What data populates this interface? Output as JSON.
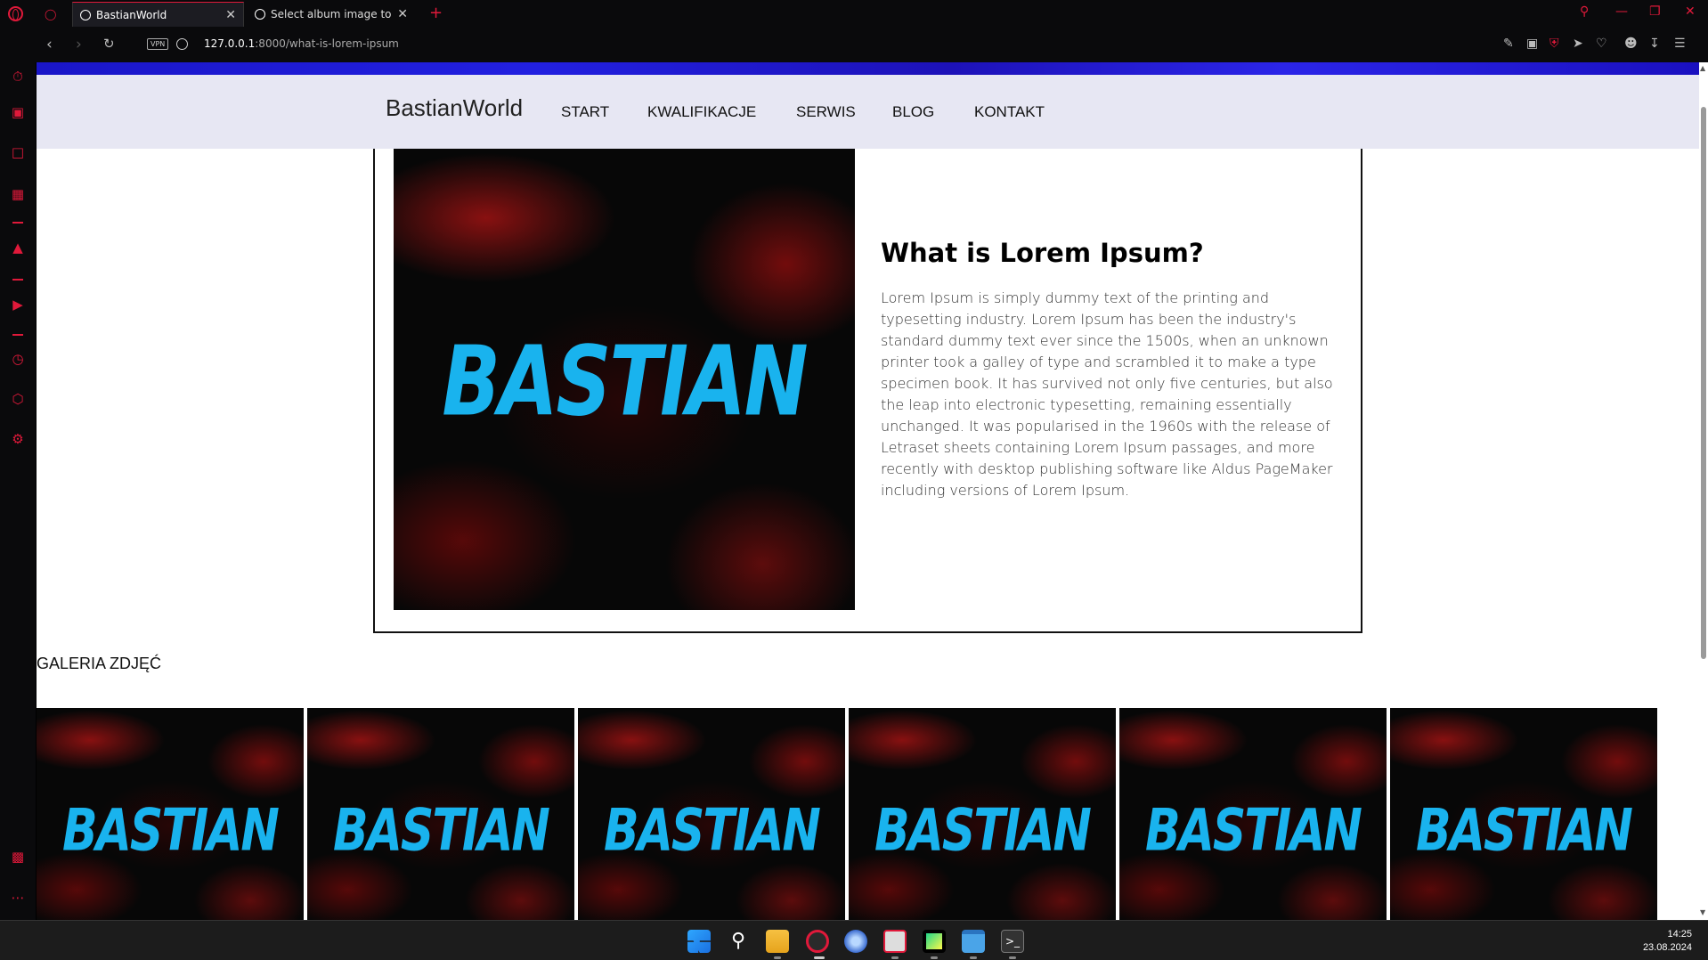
{
  "browser": {
    "tabs": [
      {
        "label": "BastianWorld"
      },
      {
        "label": "Select album image to cha"
      }
    ],
    "url_host": "127.0.0.1",
    "url_rest": ":8000/what-is-lorem-ipsum",
    "vpn_label": "VPN"
  },
  "site": {
    "brand": "BastianWorld",
    "nav": [
      "START",
      "KWALIFIKACJE",
      "SERWIS",
      "BLOG",
      "KONTAKT"
    ]
  },
  "post": {
    "image_text": "BASTIAN",
    "title": "What is Lorem Ipsum?",
    "body": "Lorem Ipsum is simply dummy text of the printing and typesetting industry. Lorem Ipsum has been the industry's standard dummy text ever since the 1500s, when an unknown printer took a galley of type and scrambled it to make a type specimen book. It has survived not only five centuries, but also the leap into electronic typesetting, remaining essentially unchanged. It was popularised in the 1960s with the release of Letraset sheets containing Lorem Ipsum passages, and more recently with desktop publishing software like Aldus PageMaker including versions of Lorem Ipsum."
  },
  "gallery": {
    "title": "GALERIA ZDJĘĆ",
    "items": [
      "BASTIAN",
      "BASTIAN",
      "BASTIAN",
      "BASTIAN",
      "BASTIAN",
      "BASTIAN"
    ]
  },
  "taskbar": {
    "time": "14:25",
    "date": "23.08.2024"
  },
  "colors": {
    "accent": "#e0193a",
    "logo_blue": "#19b3ee",
    "header_bg": "#e7e7f3"
  }
}
